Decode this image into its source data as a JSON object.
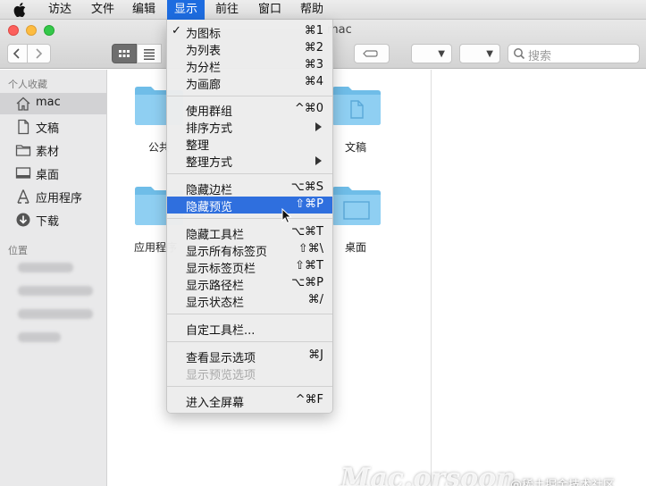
{
  "menubar": {
    "items": [
      {
        "label": "访达"
      },
      {
        "label": "文件"
      },
      {
        "label": "编辑"
      },
      {
        "label": "显示"
      },
      {
        "label": "前往"
      },
      {
        "label": "窗口"
      },
      {
        "label": "帮助"
      }
    ]
  },
  "window": {
    "title": "mac",
    "search_placeholder": "搜索"
  },
  "sidebar": {
    "favorites_header": "个人收藏",
    "favorites": [
      {
        "label": "mac",
        "icon": "home-icon"
      },
      {
        "label": "文稿",
        "icon": "document-icon"
      },
      {
        "label": "素材",
        "icon": "folder-icon"
      },
      {
        "label": "桌面",
        "icon": "desktop-icon"
      },
      {
        "label": "应用程序",
        "icon": "applications-icon"
      },
      {
        "label": "下载",
        "icon": "download-icon"
      }
    ],
    "locations_header": "位置"
  },
  "content": {
    "folders": [
      {
        "label": "公共"
      },
      {
        "label": "文稿"
      },
      {
        "label": "应用程序"
      },
      {
        "label": "桌面"
      }
    ],
    "watermark": "Mac.orsoon",
    "credit": "@稀土掘金技术社区"
  },
  "view_menu": {
    "items": [
      {
        "label": "为图标",
        "shortcut": "⌘1",
        "checked": "✓"
      },
      {
        "label": "为列表",
        "shortcut": "⌘2"
      },
      {
        "label": "为分栏",
        "shortcut": "⌘3"
      },
      {
        "label": "为画廊",
        "shortcut": "⌘4"
      },
      {
        "label": "使用群组",
        "shortcut": "^⌘0"
      },
      {
        "label": "排序方式",
        "shortcut": ""
      },
      {
        "label": "整理",
        "shortcut": ""
      },
      {
        "label": "整理方式",
        "shortcut": ""
      },
      {
        "label": "隐藏边栏",
        "shortcut": "⌥⌘S"
      },
      {
        "label": "隐藏预览",
        "shortcut": "⇧⌘P"
      },
      {
        "label": "隐藏工具栏",
        "shortcut": "⌥⌘T"
      },
      {
        "label": "显示所有标签页",
        "shortcut": "⇧⌘\\"
      },
      {
        "label": "显示标签页栏",
        "shortcut": "⇧⌘T"
      },
      {
        "label": "显示路径栏",
        "shortcut": "⌥⌘P"
      },
      {
        "label": "显示状态栏",
        "shortcut": "⌘/"
      },
      {
        "label": "自定工具栏...",
        "shortcut": ""
      },
      {
        "label": "查看显示选项",
        "shortcut": "⌘J"
      },
      {
        "label": "显示预览选项",
        "shortcut": ""
      },
      {
        "label": "进入全屏幕",
        "shortcut": "^⌘F"
      }
    ]
  },
  "colors": {
    "accent": "#2f6fde",
    "folder": "#6fbde8"
  }
}
